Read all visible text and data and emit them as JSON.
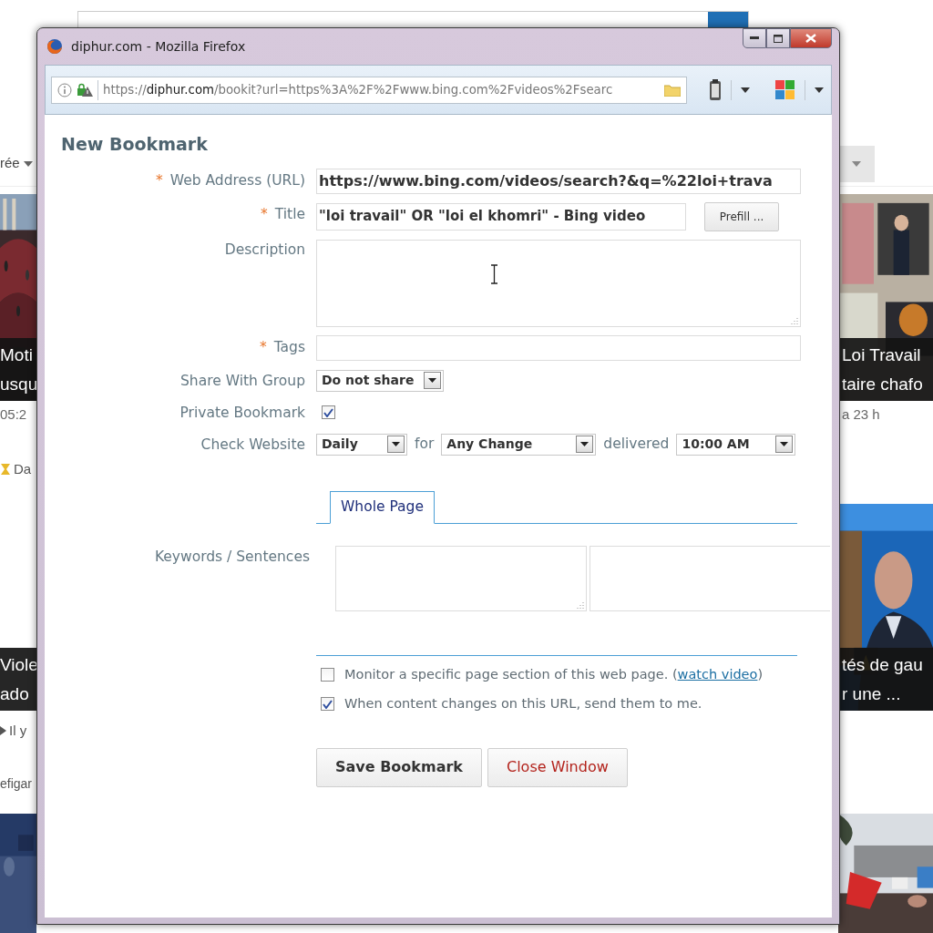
{
  "left_strip": {
    "menu": "rée",
    "cards": [
      {
        "media": {
          "kind": "picture"
        },
        "caption": [
          "Moti",
          "usqu"
        ],
        "lines": [
          {
            "kind": "time",
            "text": "05:2"
          },
          {
            "kind": "source",
            "text": "Da"
          }
        ]
      },
      {
        "caption": [
          "Viole",
          "ado"
        ],
        "lines": [
          {
            "kind": "teaser",
            "text": "Il y"
          },
          {
            "kind": "site",
            "text": "efigar"
          }
        ]
      }
    ]
  },
  "right_strip": {
    "cards": [
      {
        "media": {
          "kind": "picture"
        },
        "caption": [
          "Loi Travail",
          "taire chafo"
        ],
        "lines": [
          {
            "kind": "time",
            "text": "a 23 h"
          }
        ]
      },
      {
        "media": {
          "kind": "picture"
        },
        "caption": [
          "tés de gau",
          "r une ..."
        ]
      }
    ]
  },
  "window": {
    "title": "diphur.com - Mozilla Firefox",
    "url": "https://**diphur.com**/bookit?url=https%3A%2F%2Fwww.bing.com%2Fvideos%2Fsearc"
  },
  "form": {
    "heading": "New Bookmark",
    "fields": [
      {
        "kind": "text",
        "label": "Web Address (URL)",
        "marker": "*",
        "value": "https://www.bing.com/videos/search?&q=%22loi+trava"
      },
      {
        "kind": "text-button",
        "label": "Title",
        "marker": "*",
        "value": "\"loi travail\" OR \"loi el khomri\" - Bing video",
        "button": "Prefill ..."
      },
      {
        "kind": "textarea",
        "label": "Description"
      },
      {
        "kind": "text",
        "label": "Tags",
        "marker": "*"
      },
      {
        "kind": "select",
        "label": "Share With Group",
        "value": "Do not share"
      },
      {
        "kind": "checkbox",
        "label": "Private Bookmark",
        "checked": true
      },
      {
        "kind": "schedule",
        "label": "Check Website",
        "parts": [
          {
            "kind": "select",
            "value": "Daily"
          },
          {
            "kind": "word",
            "text": "for"
          },
          {
            "kind": "select",
            "value": "Any Change"
          },
          {
            "kind": "word",
            "text": "delivered"
          },
          {
            "kind": "select",
            "value": "10:00 AM"
          }
        ]
      }
    ],
    "tabs": [
      {
        "label": "Whole Page",
        "selected": true
      }
    ],
    "keywords_label": "Keywords / Sentences",
    "options": [
      {
        "checked": false,
        "text": "Monitor a specific page section of this web page. (",
        "link": "watch video",
        "after": ")"
      },
      {
        "checked": true,
        "text": "When content changes on this URL, send them to me."
      }
    ],
    "buttons": [
      {
        "kind": "save",
        "label": "Save Bookmark"
      },
      {
        "kind": "close",
        "label": "Close Window"
      }
    ]
  }
}
